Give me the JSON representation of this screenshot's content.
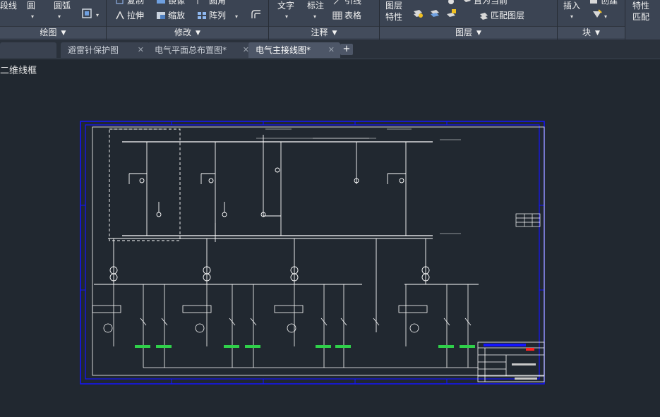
{
  "ribbon": {
    "draw": {
      "polyline": "段线",
      "circle": "圆",
      "arc": "圆弧",
      "title": "绘图"
    },
    "modify": {
      "copy": "复制",
      "stretch": "拉伸",
      "mirror": "镜像",
      "scale": "缩放",
      "fillet": "圆角",
      "array": "阵列",
      "title": "修改"
    },
    "annotation": {
      "text": "文字",
      "dimension": "标注",
      "leader": "引线",
      "table": "表格",
      "title": "注释"
    },
    "layers": {
      "layer": "图层",
      "properties": "特性",
      "make_current": "置为当前",
      "match_layer": "匹配图层",
      "title": "图层"
    },
    "block": {
      "insert": "插入",
      "create": "创建",
      "title": "块"
    },
    "properties": {
      "properties": "特性",
      "match": "匹配"
    }
  },
  "tabs": [
    {
      "label": "避雷针保护图",
      "active": false
    },
    {
      "label": "电气平面总布置图*",
      "active": false
    },
    {
      "label": "电气主接线图*",
      "active": true
    }
  ],
  "view_label": "二维线框",
  "colors": {
    "ribbon_bg": "#3b4453",
    "canvas_bg": "#212830",
    "frame": "#1414ff",
    "lines": "#ffffff",
    "green": "#2fd04a",
    "red": "#ff2020"
  }
}
